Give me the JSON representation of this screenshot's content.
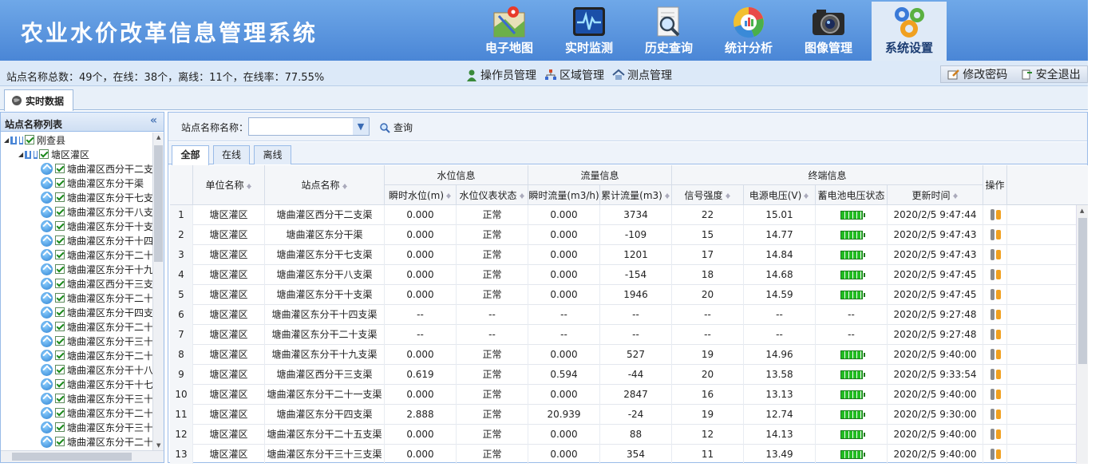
{
  "app": {
    "title": "农业水价改革信息管理系统",
    "nav": [
      {
        "label": "电子地图",
        "icon": "map-icon"
      },
      {
        "label": "实时监测",
        "icon": "monitor-icon"
      },
      {
        "label": "历史查询",
        "icon": "history-search-icon"
      },
      {
        "label": "统计分析",
        "icon": "pie-chart-icon"
      },
      {
        "label": "图像管理",
        "icon": "camera-icon"
      },
      {
        "label": "系统设置",
        "icon": "gears-icon",
        "active": true
      }
    ]
  },
  "status": {
    "summary": "站点名称总数：49个，在线：38个，离线：11个，在线率：77.55%",
    "links": {
      "operator": "操作员管理",
      "region": "区域管理",
      "station": "测点管理"
    },
    "user": {
      "change_password": "修改密码",
      "logout": "安全退出"
    }
  },
  "tabs": {
    "realtime": "实时数据"
  },
  "sidebar": {
    "title": "站点名称列表",
    "root": "刚查县",
    "group": "塘区灌区",
    "items": [
      "塘曲灌区西分干二支",
      "塘曲灌区东分干渠",
      "塘曲灌区东分干七支",
      "塘曲灌区东分干八支",
      "塘曲灌区东分干十支",
      "塘曲灌区东分干十四",
      "塘曲灌区东分干二十",
      "塘曲灌区东分干十九",
      "塘曲灌区西分干三支",
      "塘曲灌区东分干二十",
      "塘曲灌区东分干四支",
      "塘曲灌区东分干二十",
      "塘曲灌区东分干三十",
      "塘曲灌区东分干二十",
      "塘曲灌区东分干十八",
      "塘曲灌区东分干十七",
      "塘曲灌区东分干三十",
      "塘曲灌区东分干二十",
      "塘曲灌区东分干三十",
      "塘曲灌区东分干二十"
    ]
  },
  "search": {
    "label": "站点名称名称：",
    "value": "",
    "button": "查询"
  },
  "subtabs": [
    "全部",
    "在线",
    "离线"
  ],
  "grid": {
    "headers": {
      "unit": "单位名称",
      "station": "站点名称",
      "water_group": "水位信息",
      "flow_group": "流量信息",
      "terminal_group": "终端信息",
      "op": "操作",
      "water_level": "瞬时水位(m)",
      "meter_state": "水位仪表状态",
      "inst_flow": "瞬时流量(m3/h)",
      "cum_flow": "累计流量(m3)",
      "signal": "信号强度",
      "voltage": "电源电压(V)",
      "battery": "蓄电池电压状态",
      "updated": "更新时间"
    },
    "rows": [
      {
        "n": "1",
        "unit": "塘区灌区",
        "station": "塘曲灌区西分干二支渠",
        "level": "0.000",
        "state": "正常",
        "flow": "0.000",
        "cum": "3734",
        "signal": "22",
        "volt": "15.01",
        "battery": true,
        "time": "2020/2/5 9:47:44"
      },
      {
        "n": "2",
        "unit": "塘区灌区",
        "station": "塘曲灌区东分干渠",
        "level": "0.000",
        "state": "正常",
        "flow": "0.000",
        "cum": "-109",
        "signal": "15",
        "volt": "14.77",
        "battery": true,
        "time": "2020/2/5 9:47:43"
      },
      {
        "n": "3",
        "unit": "塘区灌区",
        "station": "塘曲灌区东分干七支渠",
        "level": "0.000",
        "state": "正常",
        "flow": "0.000",
        "cum": "1201",
        "signal": "17",
        "volt": "14.84",
        "battery": true,
        "time": "2020/2/5 9:47:43"
      },
      {
        "n": "4",
        "unit": "塘区灌区",
        "station": "塘曲灌区东分干八支渠",
        "level": "0.000",
        "state": "正常",
        "flow": "0.000",
        "cum": "-154",
        "signal": "18",
        "volt": "14.68",
        "battery": true,
        "time": "2020/2/5 9:47:45"
      },
      {
        "n": "5",
        "unit": "塘区灌区",
        "station": "塘曲灌区东分干十支渠",
        "level": "0.000",
        "state": "正常",
        "flow": "0.000",
        "cum": "1946",
        "signal": "20",
        "volt": "14.59",
        "battery": true,
        "time": "2020/2/5 9:47:45"
      },
      {
        "n": "6",
        "unit": "塘区灌区",
        "station": "塘曲灌区东分干十四支渠",
        "level": "--",
        "state": "--",
        "flow": "--",
        "cum": "--",
        "signal": "--",
        "volt": "--",
        "battery": false,
        "battery_text": "--",
        "time": "2020/2/5 9:27:48"
      },
      {
        "n": "7",
        "unit": "塘区灌区",
        "station": "塘曲灌区东分干二十支渠",
        "level": "--",
        "state": "--",
        "flow": "--",
        "cum": "--",
        "signal": "--",
        "volt": "--",
        "battery": false,
        "battery_text": "--",
        "time": "2020/2/5 9:27:48"
      },
      {
        "n": "8",
        "unit": "塘区灌区",
        "station": "塘曲灌区东分干十九支渠",
        "level": "0.000",
        "state": "正常",
        "flow": "0.000",
        "cum": "527",
        "signal": "19",
        "volt": "14.96",
        "battery": true,
        "time": "2020/2/5 9:40:00"
      },
      {
        "n": "9",
        "unit": "塘区灌区",
        "station": "塘曲灌区西分干三支渠",
        "level": "0.619",
        "state": "正常",
        "flow": "0.594",
        "cum": "-44",
        "signal": "20",
        "volt": "13.58",
        "battery": true,
        "time": "2020/2/5 9:33:54"
      },
      {
        "n": "10",
        "unit": "塘区灌区",
        "station": "塘曲灌区东分干二十一支渠",
        "level": "0.000",
        "state": "正常",
        "flow": "0.000",
        "cum": "2847",
        "signal": "16",
        "volt": "13.13",
        "battery": true,
        "time": "2020/2/5 9:40:00"
      },
      {
        "n": "11",
        "unit": "塘区灌区",
        "station": "塘曲灌区东分干四支渠",
        "level": "2.888",
        "state": "正常",
        "flow": "20.939",
        "cum": "-24",
        "signal": "19",
        "volt": "12.74",
        "battery": true,
        "time": "2020/2/5 9:30:00"
      },
      {
        "n": "12",
        "unit": "塘区灌区",
        "station": "塘曲灌区东分干二十五支渠",
        "level": "0.000",
        "state": "正常",
        "flow": "0.000",
        "cum": "88",
        "signal": "12",
        "volt": "14.13",
        "battery": true,
        "time": "2020/2/5 9:40:00"
      },
      {
        "n": "13",
        "unit": "塘区灌区",
        "station": "塘曲灌区东分干三十三支渠",
        "level": "0.000",
        "state": "正常",
        "flow": "0.000",
        "cum": "354",
        "signal": "11",
        "volt": "13.49",
        "battery": true,
        "time": "2020/2/5 9:40:00"
      }
    ]
  }
}
